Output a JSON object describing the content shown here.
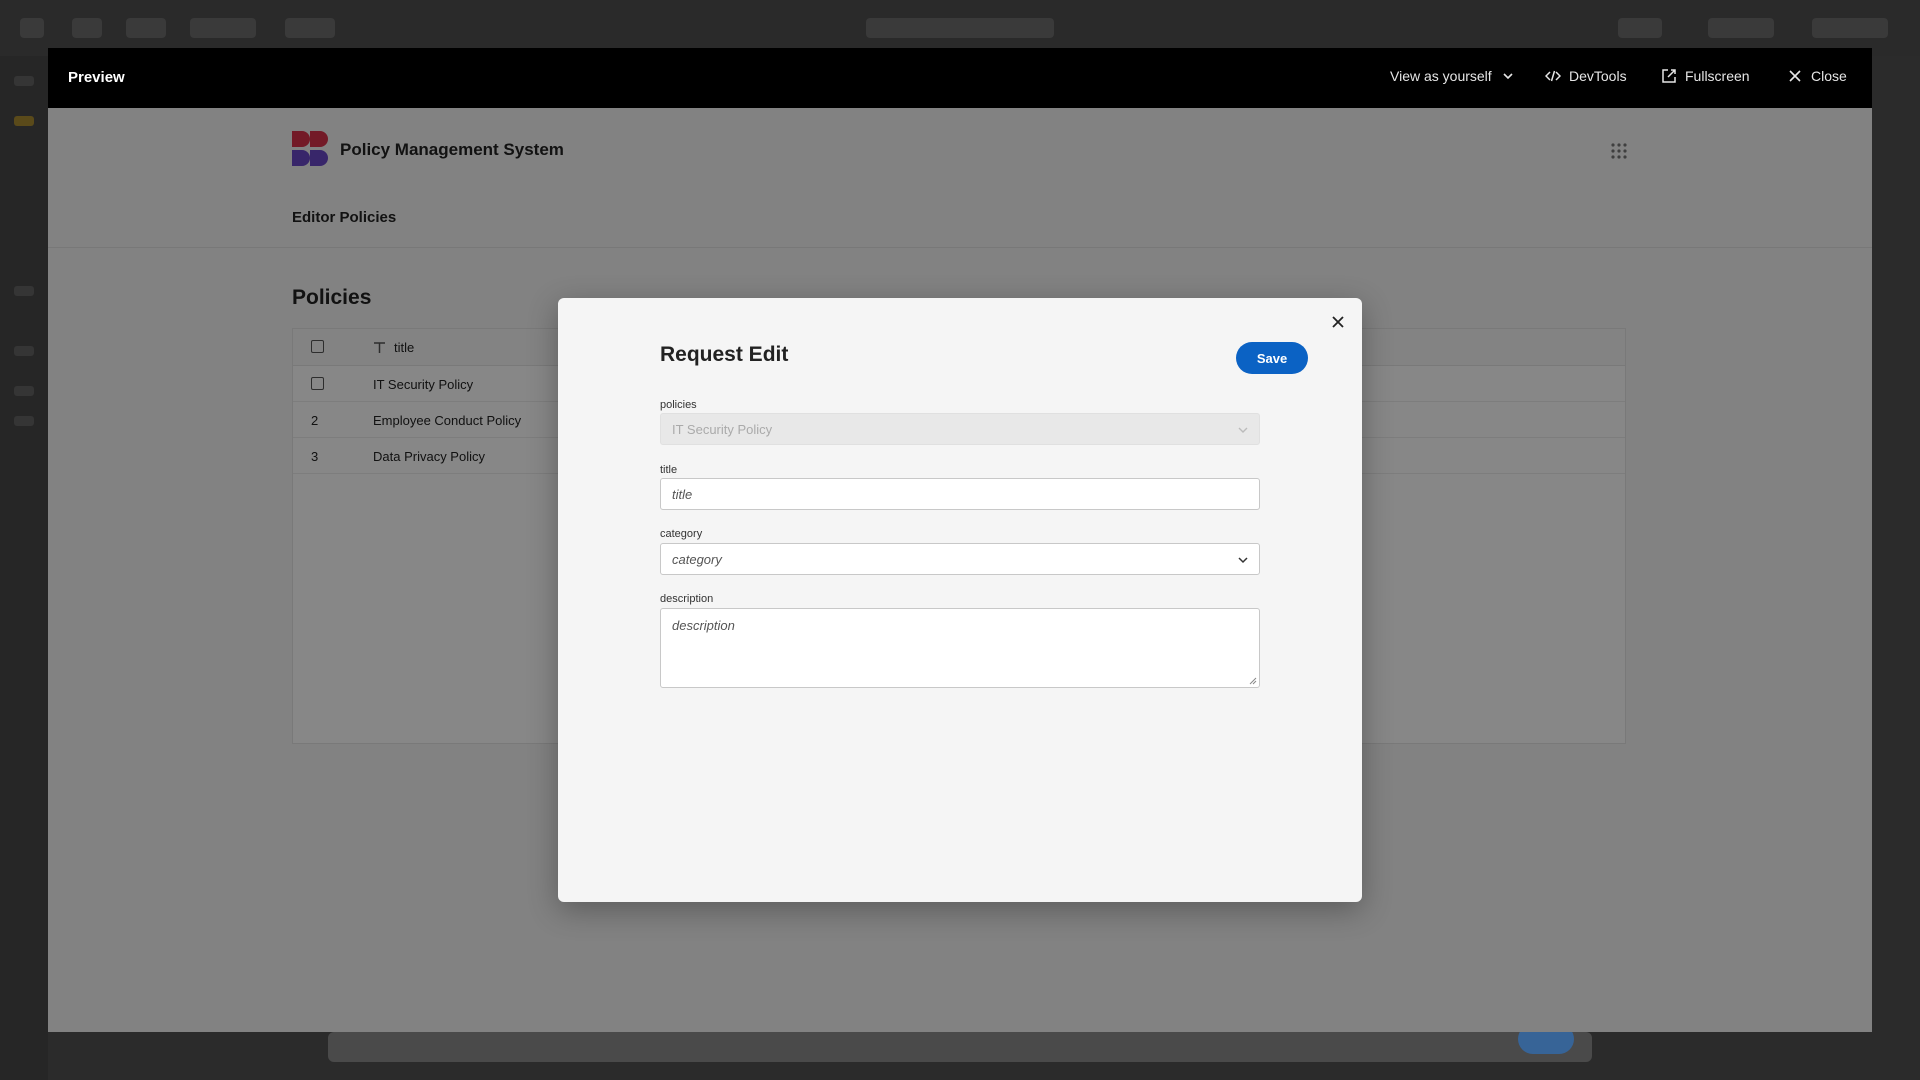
{
  "preview": {
    "title": "Preview",
    "view_as": "View as yourself",
    "devtools": "DevTools",
    "fullscreen": "Fullscreen",
    "close": "Close"
  },
  "app": {
    "name": "Policy Management System",
    "nav": [
      "Editor Policies"
    ],
    "page_title": "Policies",
    "table": {
      "columns": [
        "title"
      ],
      "rows": [
        {
          "index": "",
          "title": "IT Security Policy"
        },
        {
          "index": "2",
          "title": "Employee Conduct Policy"
        },
        {
          "index": "3",
          "title": "Data Privacy Policy"
        }
      ]
    },
    "logo_colors": {
      "red": "#d9324a",
      "purple": "#6b48c9"
    }
  },
  "modal": {
    "title": "Request Edit",
    "save_label": "Save",
    "fields": {
      "policies": {
        "label": "policies",
        "value": "IT Security Policy",
        "disabled": true
      },
      "title": {
        "label": "title",
        "placeholder": "title"
      },
      "category": {
        "label": "category",
        "placeholder": "category"
      },
      "description": {
        "label": "description",
        "placeholder": "description"
      }
    }
  },
  "colors": {
    "accent": "#0b62c4",
    "header_bg": "#000000"
  }
}
